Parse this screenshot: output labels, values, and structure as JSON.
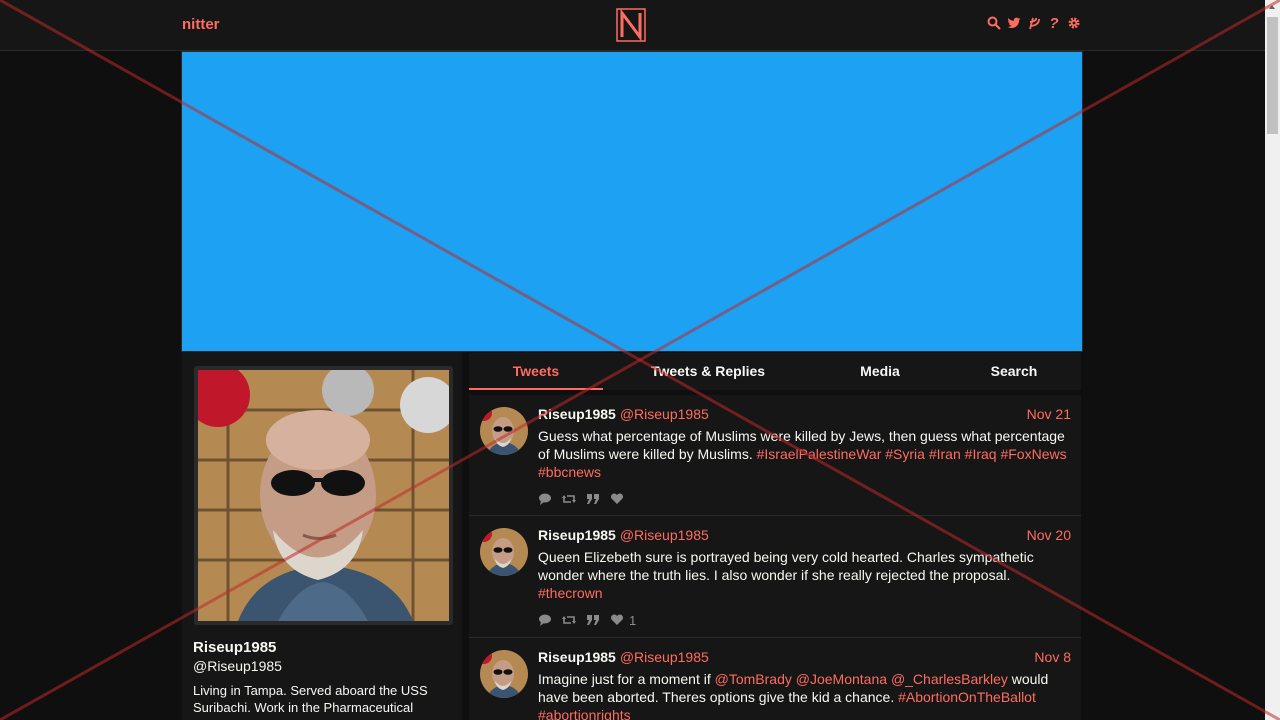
{
  "nav": {
    "brand": "nitter",
    "logo_letter": "N",
    "icons": [
      "search-icon",
      "twitter-bird-icon",
      "rss-icon",
      "help-icon",
      "gear-icon"
    ]
  },
  "colors": {
    "accent": "#ff6c60",
    "background": "#0f0f0f",
    "card": "#161616",
    "banner": "#1da1f2",
    "text": "#f8f8f2",
    "overlay": "#c0282a"
  },
  "profile": {
    "name": "Riseup1985",
    "handle": "@Riseup1985",
    "bio_line1": "Living in Tampa. Served aboard the USS",
    "bio_line2": "Suribachi. Work in the Pharmaceutical"
  },
  "tabs": [
    {
      "label": "Tweets",
      "active": true
    },
    {
      "label": "Tweets & Replies",
      "active": false
    },
    {
      "label": "Media",
      "active": false
    },
    {
      "label": "Search",
      "active": false
    }
  ],
  "tweets": [
    {
      "name": "Riseup1985",
      "handle": "@Riseup1985",
      "date": "Nov 21",
      "text": "Guess what percentage of Muslims were killed by Jews, then guess what percentage of Muslims were killed by Muslims.",
      "tags": [
        "#IsraelPalestineWar",
        "#Syria",
        "#Iran",
        "#Iraq",
        "#FoxNews",
        "#bbcnews"
      ],
      "likes": ""
    },
    {
      "name": "Riseup1985",
      "handle": "@Riseup1985",
      "date": "Nov 20",
      "text": "Queen Elizebeth sure is portrayed being very cold hearted. Charles sympathetic wonder where the truth lies. I also wonder if she really rejected the proposal.",
      "tags": [
        "#thecrown"
      ],
      "likes": "1"
    },
    {
      "name": "Riseup1985",
      "handle": "@Riseup1985",
      "date": "Nov 8",
      "text_pre": "Imagine just for a moment if",
      "mentions": [
        "@TomBrady",
        "@JoeMontana",
        "@_CharlesBarkley"
      ],
      "text_post": "would have been aborted. Theres options give the kid a chance.",
      "tags": [
        "#AbortionOnTheBallot",
        "#abortionrights"
      ]
    }
  ]
}
